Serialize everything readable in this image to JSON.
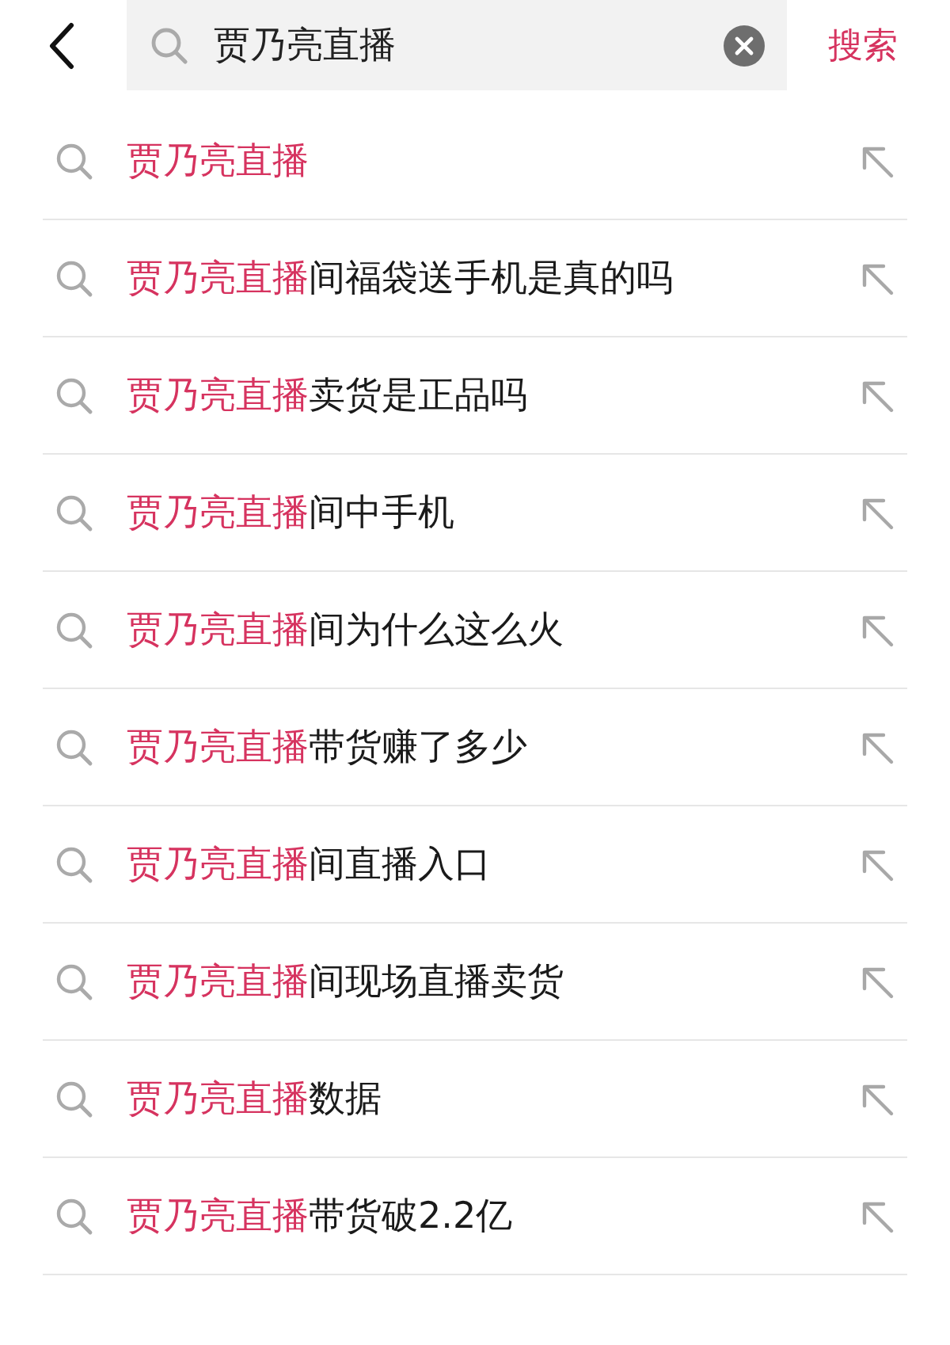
{
  "search": {
    "value": "贾乃亮直播",
    "button": "搜索"
  },
  "suggestions": [
    {
      "match": "贾乃亮直播"
    },
    {
      "match": "贾乃亮直播",
      "rest": "间福袋送手机是真的吗"
    },
    {
      "match": "贾乃亮直播",
      "rest": "卖货是正品吗"
    },
    {
      "match": "贾乃亮直播",
      "rest": "间中手机"
    },
    {
      "match": "贾乃亮直播",
      "rest": "间为什么这么火"
    },
    {
      "match": "贾乃亮直播",
      "rest": "带货赚了多少"
    },
    {
      "match": "贾乃亮直播",
      "rest": "间直播入口"
    },
    {
      "match": "贾乃亮直播",
      "rest": "间现场直播卖货"
    },
    {
      "match": "贾乃亮直播",
      "rest": "数据"
    },
    {
      "match": "贾乃亮直播",
      "rest": "带货破2.2亿"
    }
  ]
}
